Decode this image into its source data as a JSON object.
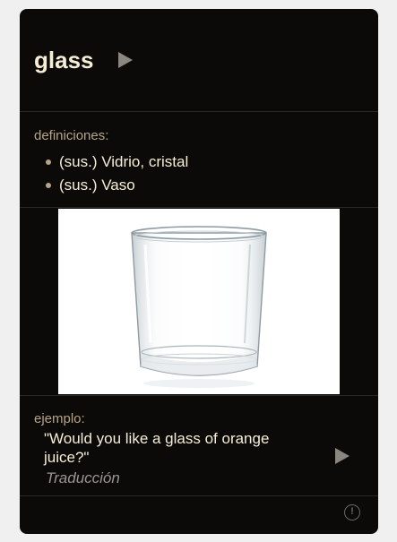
{
  "word": "glass",
  "definitions_label": "definiciones:",
  "definitions": [
    "(sus.) Vidrio, cristal",
    "(sus.) Vaso"
  ],
  "example_label": "ejemplo:",
  "example_text": "\"Would you like a glass of orange juice?\"",
  "translation_link": "Traducción",
  "icons": {
    "play": "play-icon",
    "report": "report-icon"
  },
  "colors": {
    "card_bg": "#0b0a08",
    "text": "#f5edd5",
    "label": "#b5a488",
    "muted": "#9a9590"
  }
}
